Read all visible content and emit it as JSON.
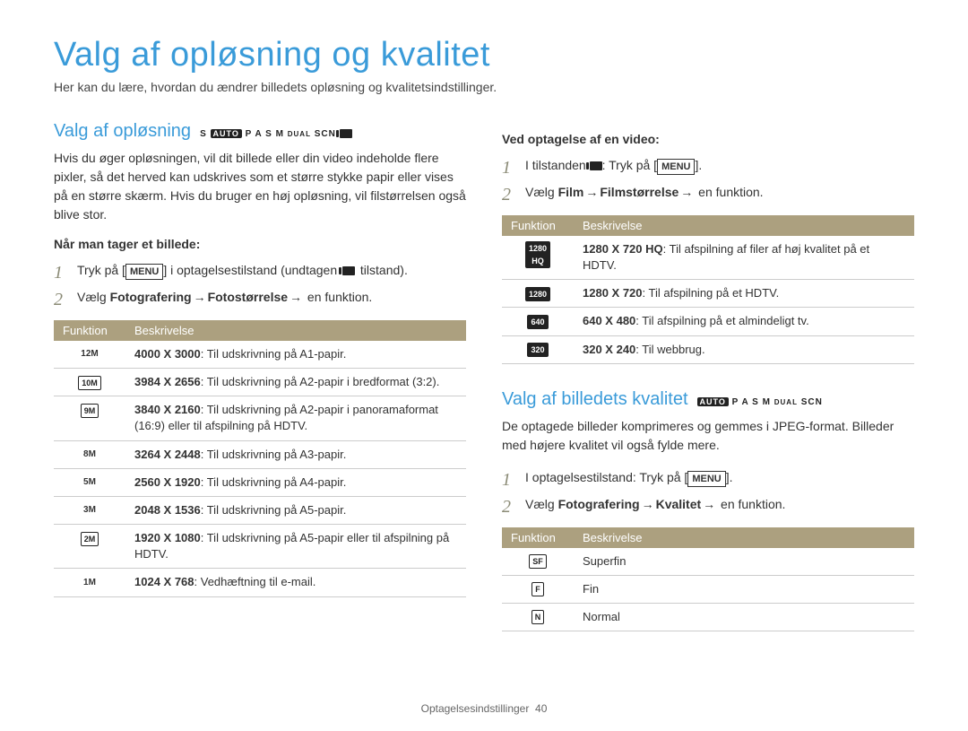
{
  "title": "Valg af opløsning og kvalitet",
  "subtitle": "Her kan du lære, hvordan du ændrer billedets opløsning og kvalitetsindstillinger.",
  "left": {
    "heading": "Valg af opløsning",
    "modes": "S AUTO P A S M DUAL SCN",
    "intro": "Hvis du øger opløsningen, vil dit billede eller din video indeholde flere pixler, så det herved kan udskrives som et større stykke papir eller vises på en større skærm. Hvis du bruger en høj opløsning, vil filstørrelsen også blive stor.",
    "photo_sub": "Når man tager et billede:",
    "step1_pre": "Tryk på [",
    "step1_label": "MENU",
    "step1_post": "] i optagelsestilstand (undtagen",
    "step1_tail": "tilstand).",
    "step2_pre": "Vælg ",
    "step2_a": "Fotografering",
    "step2_b": "Fotostørrelse",
    "step2_post": " en funktion.",
    "table_head_a": "Funktion",
    "table_head_b": "Beskrivelse",
    "rows": [
      {
        "icon": "12M",
        "desc_b": "4000 X 3000",
        "desc": ": Til udskrivning på A1-papir."
      },
      {
        "icon": "10M",
        "desc_b": "3984 X 2656",
        "desc": ": Til udskrivning på A2-papir i bredformat (3:2)."
      },
      {
        "icon": "9M",
        "desc_b": "3840 X 2160",
        "desc": ": Til udskrivning på A2-papir i panoramaformat (16:9) eller til afspilning på HDTV."
      },
      {
        "icon": "8M",
        "desc_b": "3264 X 2448",
        "desc": ": Til udskrivning på A3-papir."
      },
      {
        "icon": "5M",
        "desc_b": "2560 X 1920",
        "desc": ": Til udskrivning på A4-papir."
      },
      {
        "icon": "3M",
        "desc_b": "2048 X 1536",
        "desc": ": Til udskrivning på A5-papir."
      },
      {
        "icon": "2M",
        "desc_b": "1920 X 1080",
        "desc": ": Til udskrivning på A5-papir eller til afspilning på HDTV."
      },
      {
        "icon": "1M",
        "desc_b": "1024 X 768",
        "desc": ": Vedhæftning til e-mail."
      }
    ]
  },
  "right": {
    "video_sub": "Ved optagelse af en video:",
    "vstep1_pre": "I tilstanden ",
    "vstep1_post": ": Tryk på [",
    "vstep1_label": "MENU",
    "vstep1_close": "].",
    "vstep2_pre": "Vælg ",
    "vstep2_a": "Film",
    "vstep2_b": "Filmstørrelse",
    "vstep2_post": " en funktion.",
    "vtable_head_a": "Funktion",
    "vtable_head_b": "Beskrivelse",
    "vrows": [
      {
        "icon": "1280 HQ",
        "desc_b": "1280 X 720 HQ",
        "desc": ": Til afspilning af filer af høj kvalitet på et HDTV."
      },
      {
        "icon": "1280",
        "desc_b": "1280 X 720",
        "desc": ": Til afspilning på et HDTV."
      },
      {
        "icon": "640",
        "desc_b": "640 X 480",
        "desc": ": Til afspilning på et almindeligt tv."
      },
      {
        "icon": "320",
        "desc_b": "320 X 240",
        "desc": ": Til webbrug."
      }
    ],
    "q_heading": "Valg af billedets kvalitet",
    "q_modes": "AUTO P A S M DUAL SCN",
    "q_intro": "De optagede billeder komprimeres og gemmes i JPEG-format. Billeder med højere kvalitet vil også fylde mere.",
    "qstep1_pre": "I optagelsestilstand: Tryk på [",
    "qstep1_label": "MENU",
    "qstep1_close": "].",
    "qstep2_pre": "Vælg ",
    "qstep2_a": "Fotografering",
    "qstep2_b": "Kvalitet",
    "qstep2_post": " en funktion.",
    "qtable_head_a": "Funktion",
    "qtable_head_b": "Beskrivelse",
    "qrows": [
      {
        "icon": "SF",
        "desc": "Superfin"
      },
      {
        "icon": "F",
        "desc": "Fin"
      },
      {
        "icon": "N",
        "desc": "Normal"
      }
    ]
  },
  "footer_text": "Optagelsesindstillinger",
  "footer_page": "40"
}
